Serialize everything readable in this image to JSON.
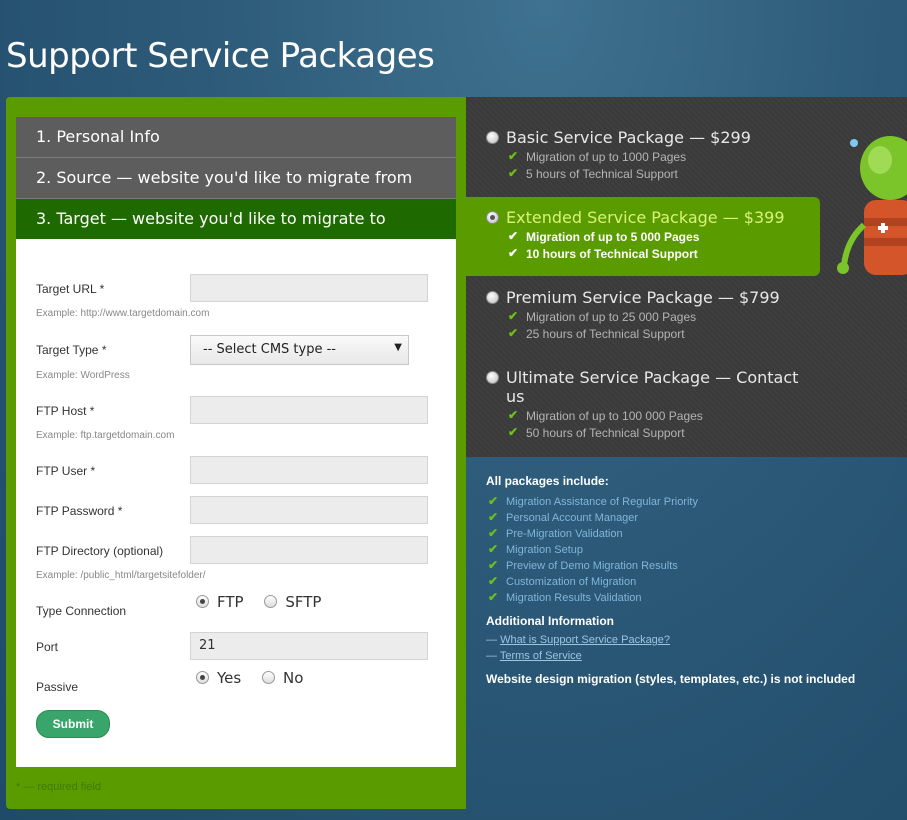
{
  "page": {
    "title": "Support Service Packages"
  },
  "steps": [
    {
      "label": "1. Personal Info"
    },
    {
      "label": "2. Source — website you'd like to migrate from"
    },
    {
      "label": "3. Target — website you'd like to migrate to"
    }
  ],
  "form": {
    "target_url": {
      "label": "Target URL *",
      "value": "",
      "example": "Example: http://www.targetdomain.com"
    },
    "target_type": {
      "label": "Target Type *",
      "selected": "-- Select CMS type --",
      "example": "Example: WordPress"
    },
    "ftp_host": {
      "label": "FTP Host *",
      "value": "",
      "example": "Example: ftp.targetdomain.com"
    },
    "ftp_user": {
      "label": "FTP User *",
      "value": ""
    },
    "ftp_password": {
      "label": "FTP Password *",
      "value": ""
    },
    "ftp_directory": {
      "label": "FTP Directory (optional)",
      "value": "",
      "example": "Example: /public_html/targetsitefolder/"
    },
    "type_connection": {
      "label": "Type Connection",
      "options": [
        "FTP",
        "SFTP"
      ],
      "selected": "FTP"
    },
    "port": {
      "label": "Port",
      "value": "21"
    },
    "passive": {
      "label": "Passive",
      "options": [
        "Yes",
        "No"
      ],
      "selected": "Yes"
    },
    "submit_label": "Submit",
    "required_note": "* — required field"
  },
  "packages": [
    {
      "title": "Basic Service Package — $299",
      "features": [
        "Migration of up to 1000 Pages",
        "5 hours of Technical Support"
      ],
      "selected": false
    },
    {
      "title": "Extended Service Package — $399",
      "features": [
        "Migration of up to 5 000 Pages",
        "10 hours of Technical Support"
      ],
      "selected": true
    },
    {
      "title": "Premium Service Package — $799",
      "features": [
        "Migration of up to 25 000 Pages",
        "25 hours of Technical Support"
      ],
      "selected": false
    },
    {
      "title": "Ultimate Service Package — Contact us",
      "features": [
        "Migration of up to 100 000 Pages",
        "50 hours of Technical Support"
      ],
      "selected": false
    }
  ],
  "includes": {
    "heading": "All packages include:",
    "items": [
      "Migration Assistance of Regular Priority",
      "Personal Account Manager",
      "Pre-Migration Validation",
      "Migration Setup",
      "Preview of Demo Migration Results",
      "Customization of Migration",
      "Migration Results Validation"
    ],
    "additional_heading": "Additional Information",
    "links": [
      "What is Support Service Package?",
      "Terms of Service"
    ],
    "link_prefix": "— ",
    "note": "Website design migration (styles, templates, etc.) is not included"
  },
  "colors": {
    "accent_green": "#5a9c00",
    "active_step": "#1f6a00",
    "panel_dark": "#3a3a3a",
    "check": "#6dbf1a"
  },
  "icons": [
    "check-icon",
    "radio-icon",
    "dropdown-arrow-icon",
    "support-robot-mascot"
  ]
}
